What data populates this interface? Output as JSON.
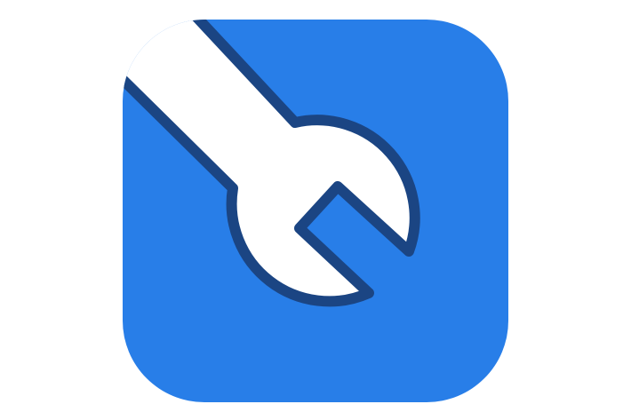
{
  "icon": {
    "name": "wrench-icon",
    "colors": {
      "background": "#ffffff",
      "tile": "#287ee8",
      "wrench_fill": "#ffffff",
      "wrench_outline": "#1b4583"
    }
  }
}
